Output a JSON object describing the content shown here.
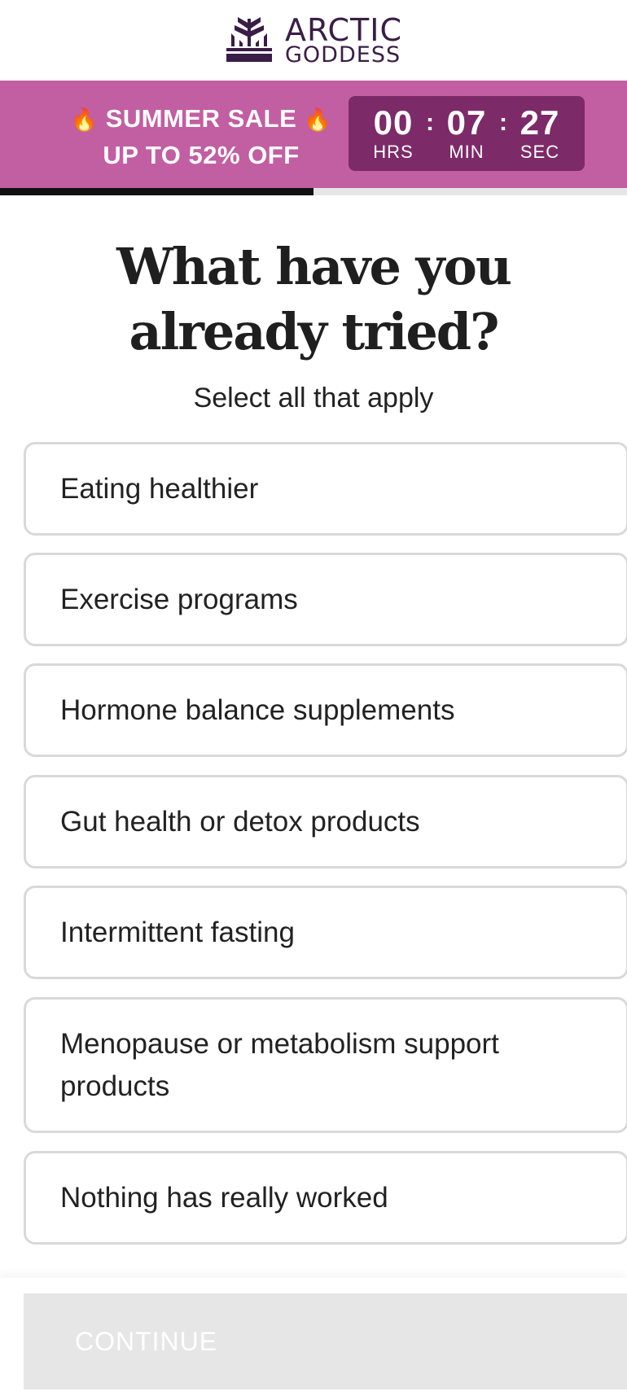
{
  "brand": {
    "logo_line1": "ARCTIC",
    "logo_line2": "GODDESS",
    "logo_icon": "pine-crown-icon"
  },
  "sale": {
    "flame_icon": "🔥",
    "line1": "SUMMER SALE",
    "line2": "UP TO 52% OFF",
    "timer": {
      "hours": "00",
      "minutes": "07",
      "seconds": "27",
      "hours_label": "HRS",
      "minutes_label": "MIN",
      "seconds_label": "SEC",
      "separator": ":"
    },
    "colors": {
      "banner": "#c25ea2",
      "timer": "#7d2a69"
    }
  },
  "progress": {
    "fraction": 0.5
  },
  "question": {
    "title": "What have you already tried?",
    "subtitle": "Select all that apply"
  },
  "options": [
    {
      "label": "Eating healthier"
    },
    {
      "label": "Exercise programs"
    },
    {
      "label": "Hormone balance supplements"
    },
    {
      "label": "Gut health or detox products"
    },
    {
      "label": "Intermittent fasting"
    },
    {
      "label": "Menopause or metabolism support products"
    },
    {
      "label": "Nothing has really worked"
    }
  ],
  "footer": {
    "continue_label": "CONTINUE"
  }
}
